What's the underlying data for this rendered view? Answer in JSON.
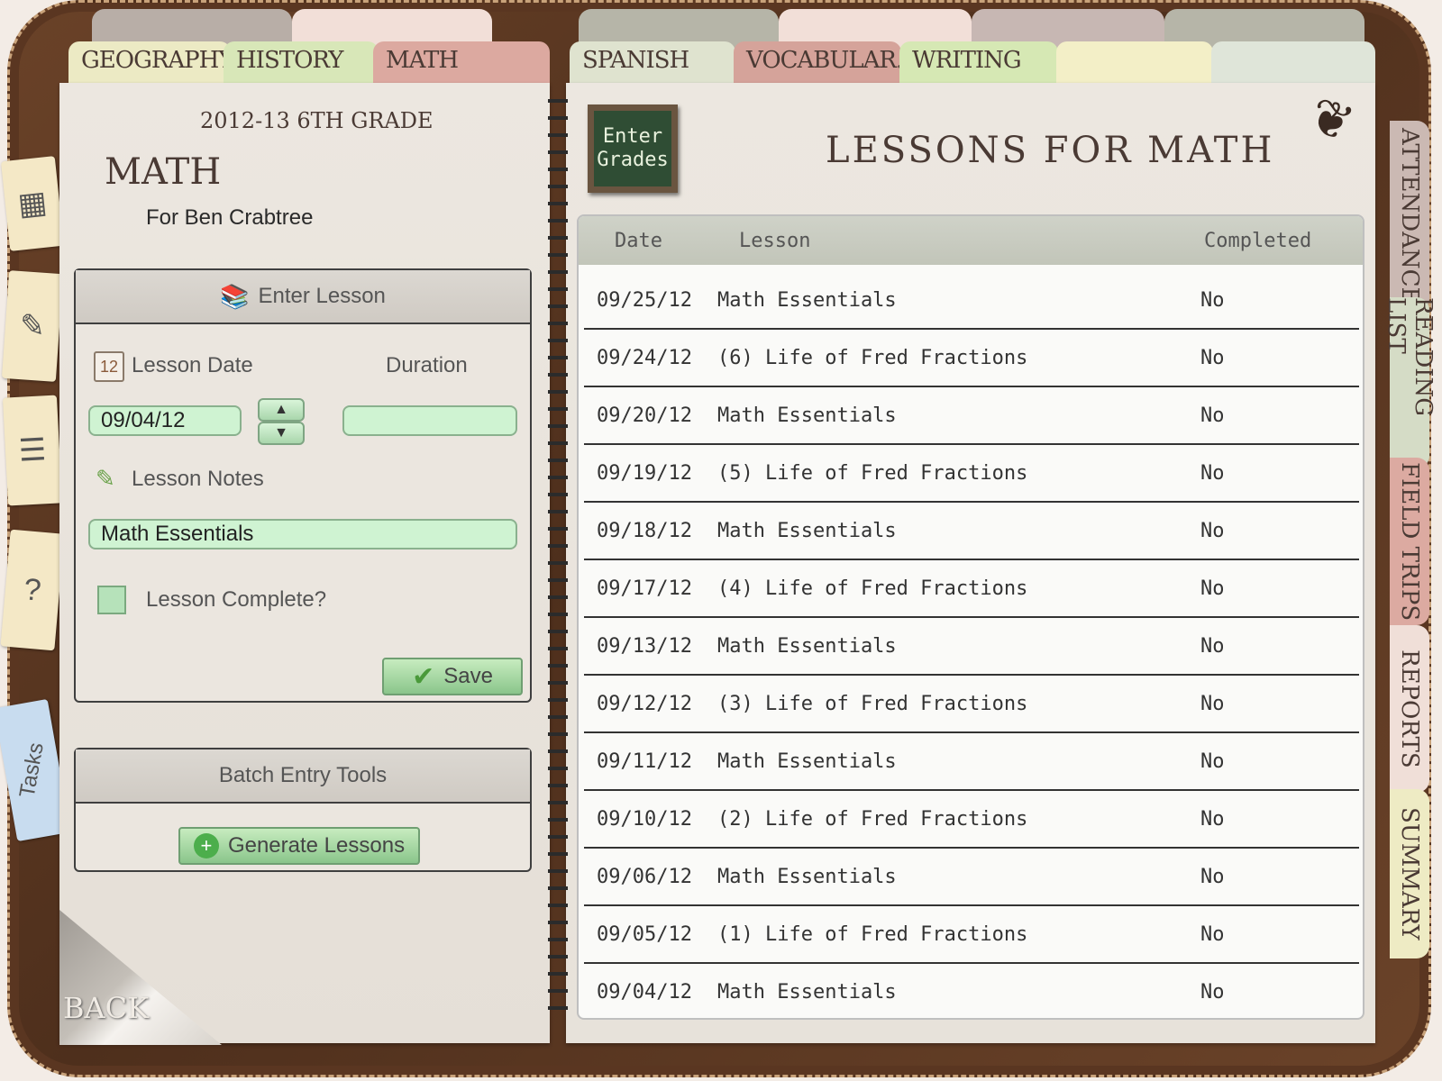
{
  "top_tabs": [
    {
      "label": "GEOGRAPHY",
      "color": "#eceac4"
    },
    {
      "label": "HISTORY",
      "color": "#d8e7b8"
    },
    {
      "label": "MATH",
      "color": "#dca9a0"
    },
    {
      "label": "SPANISH",
      "color": "#dfe3cf"
    },
    {
      "label": "VOCABULAR..",
      "color": "#d5a39a"
    },
    {
      "label": "WRITING",
      "color": "#d6e8b4"
    }
  ],
  "header": {
    "year_grade": "2012-13   6TH GRADE",
    "subject": "MATH",
    "student": "For Ben Crabtree"
  },
  "enter_lesson": {
    "title": "Enter Lesson",
    "date_label": "Lesson Date",
    "duration_label": "Duration",
    "date_value": "09/04/12",
    "duration_value": "",
    "notes_label": "Lesson Notes",
    "notes_value": "Math Essentials",
    "complete_label": "Lesson Complete?",
    "save_label": "Save"
  },
  "batch": {
    "title": "Batch Entry Tools",
    "generate_label": "Generate Lessons"
  },
  "back_label": "BACK",
  "enter_grades": {
    "line1": "Enter",
    "line2": "Grades"
  },
  "lessons_title": "LESSONS FOR MATH",
  "table": {
    "headers": {
      "date": "Date",
      "lesson": "Lesson",
      "completed": "Completed"
    },
    "rows": [
      {
        "date": "09/25/12",
        "lesson": "Math Essentials",
        "completed": "No"
      },
      {
        "date": "09/24/12",
        "lesson": "(6) Life of Fred Fractions",
        "completed": "No"
      },
      {
        "date": "09/20/12",
        "lesson": "Math Essentials",
        "completed": "No"
      },
      {
        "date": "09/19/12",
        "lesson": "(5) Life of Fred Fractions",
        "completed": "No"
      },
      {
        "date": "09/18/12",
        "lesson": "Math Essentials",
        "completed": "No"
      },
      {
        "date": "09/17/12",
        "lesson": "(4) Life of Fred Fractions",
        "completed": "No"
      },
      {
        "date": "09/13/12",
        "lesson": "Math Essentials",
        "completed": "No"
      },
      {
        "date": "09/12/12",
        "lesson": "(3) Life of Fred Fractions",
        "completed": "No"
      },
      {
        "date": "09/11/12",
        "lesson": "Math Essentials",
        "completed": "No"
      },
      {
        "date": "09/10/12",
        "lesson": "(2) Life of Fred Fractions",
        "completed": "No"
      },
      {
        "date": "09/06/12",
        "lesson": "Math Essentials",
        "completed": "No"
      },
      {
        "date": "09/05/12",
        "lesson": "(1) Life of Fred Fractions",
        "completed": "No"
      },
      {
        "date": "09/04/12",
        "lesson": "Math Essentials",
        "completed": "No"
      }
    ]
  },
  "side_tabs": [
    {
      "label": "ATTENDANCE",
      "color": "#cbb9b3"
    },
    {
      "label": "READING LIST",
      "color": "#d5dcc6"
    },
    {
      "label": "FIELD TRIPS",
      "color": "#dcaaa1"
    },
    {
      "label": "REPORTS",
      "color": "#f0dfd8"
    },
    {
      "label": "SUMMARY",
      "color": "#eeebc4"
    }
  ],
  "sticky_notes": {
    "tasks_label": "Tasks"
  }
}
